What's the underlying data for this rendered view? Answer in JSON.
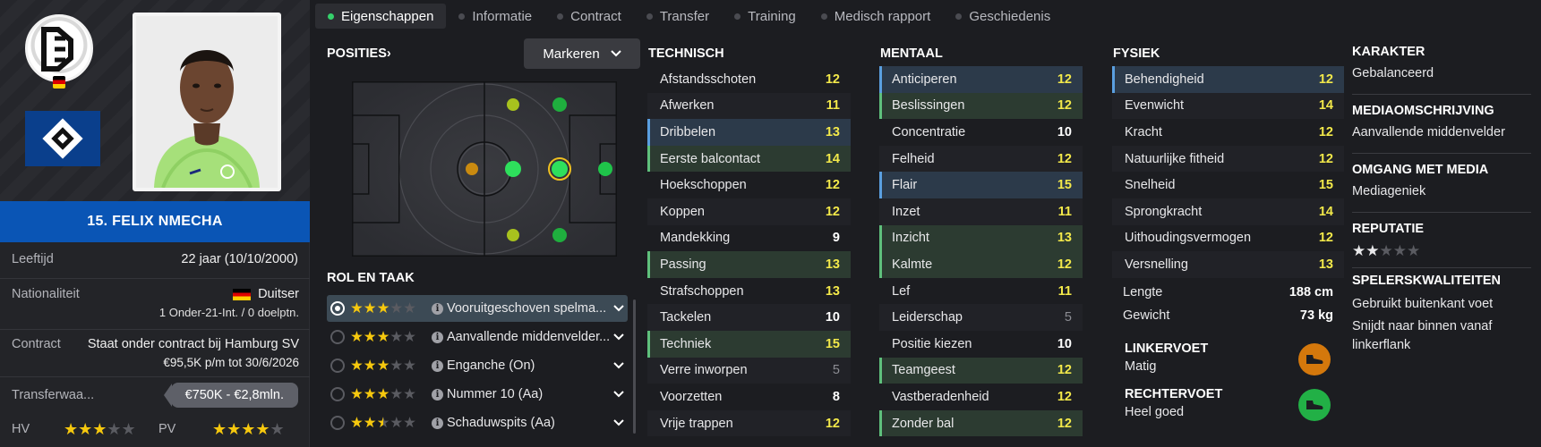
{
  "player": {
    "name": "15. FELIX NMECHA",
    "age_label": "Leeftijd",
    "age_value": "22 jaar (10/10/2000)",
    "nationality_label": "Nationaliteit",
    "nationality_value": "Duitser",
    "nationality_sub": "1 Onder-21-Int. / 0 doelptn.",
    "contract_label": "Contract",
    "contract_line1": "Staat onder contract bij Hamburg SV",
    "contract_line2": "€95,5K p/m tot 30/6/2026",
    "transfer_label": "Transferwaa...",
    "transfer_value": "€750K - €2,8mln.",
    "hv_label": "HV",
    "hv_stars": 3,
    "pv_label": "PV",
    "pv_stars": 4,
    "colors": {
      "club_blue": "#0a55b5",
      "accent_green": "#35d06b",
      "star": "#f6c80e"
    }
  },
  "tabs": [
    {
      "label": "Eigenschappen",
      "active": true
    },
    {
      "label": "Informatie"
    },
    {
      "label": "Contract"
    },
    {
      "label": "Transfer"
    },
    {
      "label": "Training"
    },
    {
      "label": "Medisch rapport"
    },
    {
      "label": "Geschiedenis"
    }
  ],
  "positions": {
    "heading": "POSITIES",
    "mark_button": "Markeren"
  },
  "roles": {
    "heading": "ROL EN TAAK",
    "items": [
      {
        "label": "Vooruitgeschoven spelma...",
        "stars": 3,
        "active": true
      },
      {
        "label": "Aanvallende middenvelder...",
        "stars": 3
      },
      {
        "label": "Enganche (On)",
        "stars": 3
      },
      {
        "label": "Nummer 10 (Aa)",
        "stars": 3
      },
      {
        "label": "Schaduwspits (Aa)",
        "stars": 2.5
      }
    ]
  },
  "technical": {
    "heading": "TECHNISCH",
    "items": [
      {
        "label": "Afstandsschoten",
        "value": "12",
        "hl": ""
      },
      {
        "label": "Afwerken",
        "value": "11",
        "hl": ""
      },
      {
        "label": "Dribbelen",
        "value": "13",
        "hl": "blue"
      },
      {
        "label": "Eerste balcontact",
        "value": "14",
        "hl": "green"
      },
      {
        "label": "Hoekschoppen",
        "value": "12",
        "hl": ""
      },
      {
        "label": "Koppen",
        "value": "12",
        "hl": ""
      },
      {
        "label": "Mandekking",
        "value": "9",
        "hl": ""
      },
      {
        "label": "Passing",
        "value": "13",
        "hl": "green"
      },
      {
        "label": "Strafschoppen",
        "value": "13",
        "hl": ""
      },
      {
        "label": "Tackelen",
        "value": "10",
        "hl": ""
      },
      {
        "label": "Techniek",
        "value": "15",
        "hl": "green"
      },
      {
        "label": "Verre inworpen",
        "value": "5",
        "hl": ""
      },
      {
        "label": "Voorzetten",
        "value": "8",
        "hl": ""
      },
      {
        "label": "Vrije trappen",
        "value": "12",
        "hl": ""
      }
    ]
  },
  "mental": {
    "heading": "MENTAAL",
    "items": [
      {
        "label": "Anticiperen",
        "value": "12",
        "hl": "blue"
      },
      {
        "label": "Beslissingen",
        "value": "12",
        "hl": "green"
      },
      {
        "label": "Concentratie",
        "value": "10",
        "hl": ""
      },
      {
        "label": "Felheid",
        "value": "12",
        "hl": ""
      },
      {
        "label": "Flair",
        "value": "15",
        "hl": "blue"
      },
      {
        "label": "Inzet",
        "value": "11",
        "hl": ""
      },
      {
        "label": "Inzicht",
        "value": "13",
        "hl": "green"
      },
      {
        "label": "Kalmte",
        "value": "12",
        "hl": "green"
      },
      {
        "label": "Lef",
        "value": "11",
        "hl": ""
      },
      {
        "label": "Leiderschap",
        "value": "5",
        "hl": ""
      },
      {
        "label": "Positie kiezen",
        "value": "10",
        "hl": ""
      },
      {
        "label": "Teamgeest",
        "value": "12",
        "hl": "green"
      },
      {
        "label": "Vastberadenheid",
        "value": "12",
        "hl": ""
      },
      {
        "label": "Zonder bal",
        "value": "12",
        "hl": "green"
      }
    ]
  },
  "physical": {
    "heading": "FYSIEK",
    "items": [
      {
        "label": "Behendigheid",
        "value": "12",
        "hl": "blue"
      },
      {
        "label": "Evenwicht",
        "value": "14",
        "hl": ""
      },
      {
        "label": "Kracht",
        "value": "12",
        "hl": ""
      },
      {
        "label": "Natuurlijke fitheid",
        "value": "12",
        "hl": ""
      },
      {
        "label": "Snelheid",
        "value": "15",
        "hl": ""
      },
      {
        "label": "Sprongkracht",
        "value": "14",
        "hl": ""
      },
      {
        "label": "Uithoudingsvermogen",
        "value": "12",
        "hl": ""
      },
      {
        "label": "Versnelling",
        "value": "13",
        "hl": ""
      }
    ],
    "height_label": "Lengte",
    "height_value": "188 cm",
    "weight_label": "Gewicht",
    "weight_value": "73 kg",
    "left_foot_title": "LINKERVOET",
    "left_foot_value": "Matig",
    "right_foot_title": "RECHTERVOET",
    "right_foot_value": "Heel goed"
  },
  "character": {
    "karakter_title": "KARAKTER",
    "karakter_value": "Gebalanceerd",
    "media_desc_title": "MEDIAOMSCHRIJVING",
    "media_desc_value": "Aanvallende middenvelder",
    "media_handling_title": "OMGANG MET MEDIA",
    "media_handling_value": "Mediageniek",
    "reputation_title": "REPUTATIE",
    "reputation_stars": 2,
    "qualities_title": "SPELERSKWALITEITEN",
    "qualities": [
      "Gebruikt buitenkant voet",
      "Snijdt naar binnen vanaf linkerflank"
    ]
  },
  "icons": [
    "dfb-crest-icon",
    "hsv-crest-icon",
    "german-flag-icon",
    "chevron-down-icon",
    "chevron-right-icon",
    "info-icon",
    "boot-icon"
  ]
}
